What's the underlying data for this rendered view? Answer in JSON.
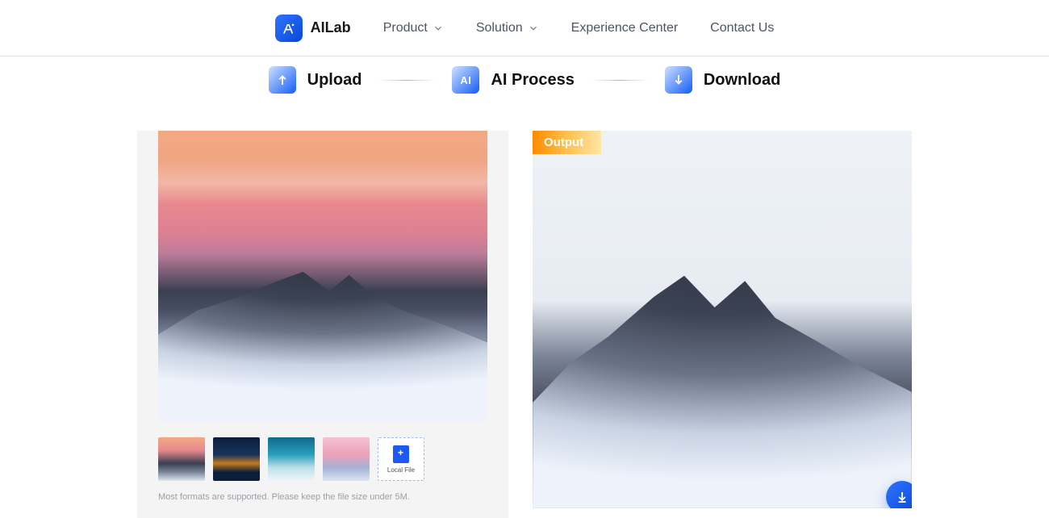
{
  "brand": {
    "name": "AILab"
  },
  "nav": {
    "product": "Product",
    "solution": "Solution",
    "experience_center": "Experience Center",
    "contact_us": "Contact Us"
  },
  "steps": {
    "upload": "Upload",
    "ai_process": "AI Process",
    "download": "Download",
    "ai_icon_text": "AI"
  },
  "workspace": {
    "output_badge": "Output",
    "local_file_label": "Local File",
    "hint": "Most formats are supported. Please keep the file size under 5M."
  }
}
